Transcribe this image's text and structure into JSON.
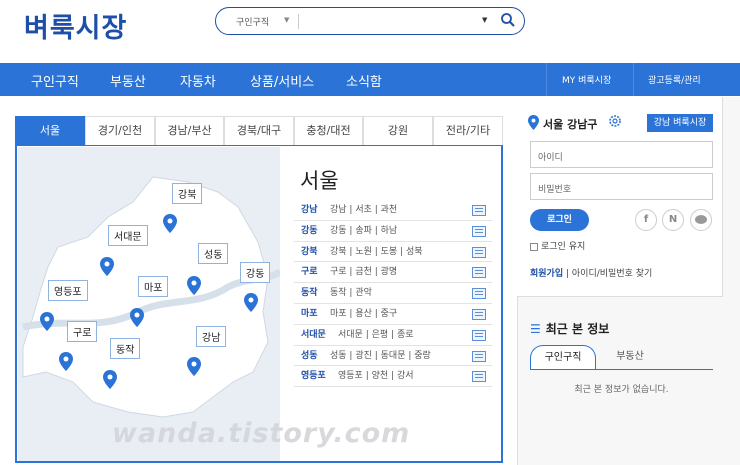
{
  "header": {
    "logo": "벼룩시장",
    "search_category": "구인구직",
    "search_value": ""
  },
  "nav": {
    "items": [
      "구인구직",
      "부동산",
      "자동차",
      "상품/서비스",
      "소식함"
    ],
    "right": [
      "MY 벼룩시장",
      "광고등록/관리"
    ]
  },
  "tabs": [
    "서울",
    "경기/인천",
    "경남/부산",
    "경북/대구",
    "충청/대전",
    "강원",
    "전라/기타"
  ],
  "map": {
    "districts": [
      "강북",
      "서대문",
      "성동",
      "강동",
      "영등포",
      "마포",
      "구로",
      "동작",
      "강남"
    ]
  },
  "region": {
    "title": "서울",
    "rows": [
      {
        "key": "강남",
        "areas": [
          "강남",
          "서초",
          "과천"
        ]
      },
      {
        "key": "강동",
        "areas": [
          "강동",
          "송파",
          "하남"
        ]
      },
      {
        "key": "강북",
        "areas": [
          "강북",
          "노원",
          "도봉",
          "성북"
        ]
      },
      {
        "key": "구로",
        "areas": [
          "구로",
          "금천",
          "광명"
        ]
      },
      {
        "key": "동작",
        "areas": [
          "동작",
          "관악"
        ]
      },
      {
        "key": "마포",
        "areas": [
          "마포",
          "용산",
          "중구"
        ]
      },
      {
        "key": "서대문",
        "areas": [
          "서대문",
          "은평",
          "종로"
        ]
      },
      {
        "key": "성동",
        "areas": [
          "성동",
          "광진",
          "동대문",
          "중랑"
        ]
      },
      {
        "key": "영등포",
        "areas": [
          "영등포",
          "양천",
          "강서"
        ]
      }
    ]
  },
  "sidebar": {
    "location": "서울 강남구",
    "badge": "강남 벼룩시장",
    "id_placeholder": "아이디",
    "pw_placeholder": "비밀번호",
    "login": "로그인",
    "social": [
      "f",
      "N"
    ],
    "keep_login": "로그인 유지",
    "join": "회원가입",
    "find": "아이디/비밀번호 찾기",
    "recent_title": "최근 본 정보",
    "recent_tabs": [
      "구인구직",
      "부동산"
    ],
    "recent_empty": "최근 본 정보가 없습니다."
  },
  "watermark": "wanda.tistory.com",
  "colors": {
    "accent": "#2b73d6",
    "logo": "#1e4fa8"
  }
}
